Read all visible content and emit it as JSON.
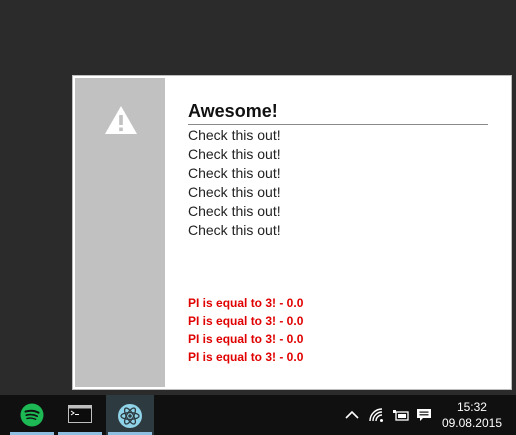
{
  "notification": {
    "icon": "warning-triangle-icon",
    "title": "Awesome!",
    "messages": [
      "Check this out!",
      "Check this out!",
      "Check this out!",
      "Check this out!",
      "Check this out!",
      "Check this out!"
    ],
    "errors": [
      "PI is equal to 3! - 0.0",
      "PI is equal to 3! - 0.0",
      "PI is equal to 3! - 0.0",
      "PI is equal to 3! - 0.0"
    ],
    "error_color": "#e00000",
    "side_panel_color": "#c1c1c1"
  },
  "taskbar": {
    "apps": [
      {
        "name": "spotify-icon",
        "active": false,
        "color": "#1db954"
      },
      {
        "name": "terminal-icon",
        "active": false
      },
      {
        "name": "electron-icon",
        "active": true,
        "color": "#8fd3e8"
      }
    ],
    "tray": [
      "chevron-up-icon",
      "wifi-icon",
      "battery-icon",
      "action-center-icon"
    ],
    "clock": {
      "time": "15:32",
      "date": "09.08.2015"
    }
  }
}
